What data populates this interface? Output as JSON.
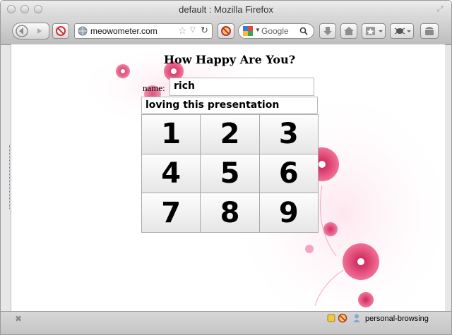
{
  "window": {
    "title": "default : Mozilla Firefox"
  },
  "toolbar": {
    "url": "meowometer.com",
    "search_placeholder": "Google"
  },
  "page": {
    "heading": "How Happy Are You?",
    "name_label": "name:",
    "name_value": "rich",
    "message_value": "loving this presentation",
    "keys": [
      "1",
      "2",
      "3",
      "4",
      "5",
      "6",
      "7",
      "8",
      "9"
    ]
  },
  "statusbar": {
    "profile": "personal-browsing"
  },
  "colors": {
    "flower_pink": "#e8306a",
    "flower_light": "#f7b7c9"
  }
}
